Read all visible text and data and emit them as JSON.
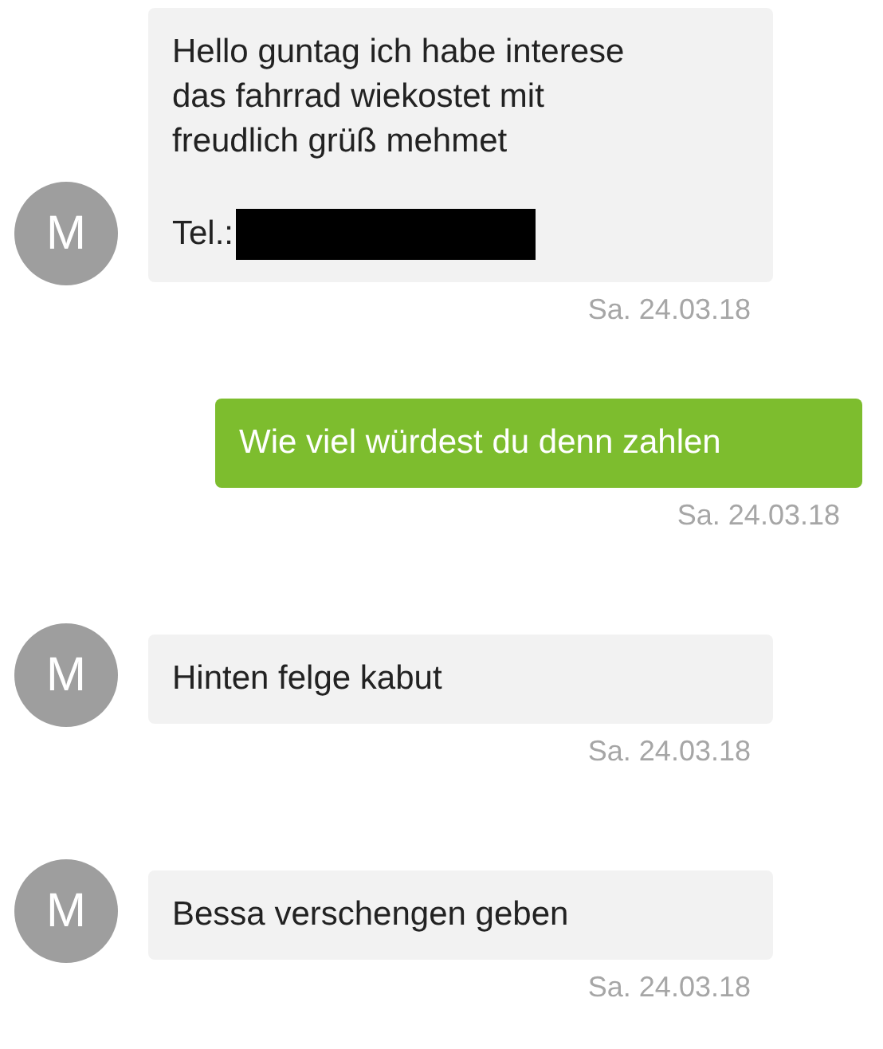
{
  "messages": [
    {
      "kind": "received",
      "avatar": "M",
      "text": "Hello guntag ich habe interese\ndas fahrrad wiekostet mit\nfreudlich grüß mehmet",
      "phone_label": "Tel.:",
      "phone_redacted": true,
      "date": "Sa. 24.03.18"
    },
    {
      "kind": "sent",
      "text": "Wie viel würdest du denn zahlen",
      "date": "Sa. 24.03.18"
    },
    {
      "kind": "received",
      "avatar": "M",
      "text": "Hinten felge kabut",
      "date": "Sa. 24.03.18"
    },
    {
      "kind": "received",
      "avatar": "M",
      "text": "Bessa verschengen geben",
      "date": "Sa. 24.03.18"
    }
  ]
}
